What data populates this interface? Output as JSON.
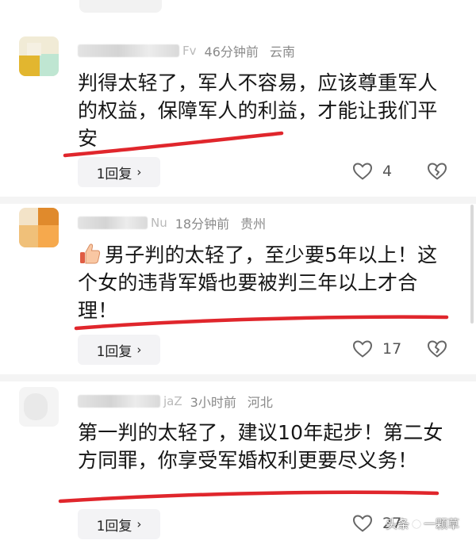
{
  "comments": [
    {
      "name_tail": "Fv",
      "time": "46分钟前",
      "location": "云南",
      "text": "判得太轻了，军人不容易，应该尊重军人的权益，保障军人的利益，才能让我们平安",
      "reply_label": "1回复",
      "likes": "4",
      "has_thumb_emoji": false
    },
    {
      "name_tail": "Nu",
      "time": "18分钟前",
      "location": "贵州",
      "text": "男子判的太轻了，至少要5年以上！这个女的违背军婚也要被判三年以上才合理！",
      "reply_label": "1回复",
      "likes": "17",
      "has_thumb_emoji": true
    },
    {
      "name_tail": "jaZ",
      "time": "3小时前",
      "location": "河北",
      "text": "第一判的太轻了，建议10年起步！第二女方同罪，你享受军婚权利更要尽义务！",
      "reply_label": "1回复",
      "likes": "27",
      "has_thumb_emoji": false
    }
  ],
  "watermark": {
    "prefix": "头条",
    "author": "一颗草"
  },
  "colors": {
    "underline": "#e0262c",
    "meta_text": "#8a8a8a",
    "reply_bg": "#f3f3f5"
  },
  "icons": [
    "heart-icon",
    "broken-heart-icon",
    "thumbs-up-emoji",
    "chevron-right-icon"
  ]
}
